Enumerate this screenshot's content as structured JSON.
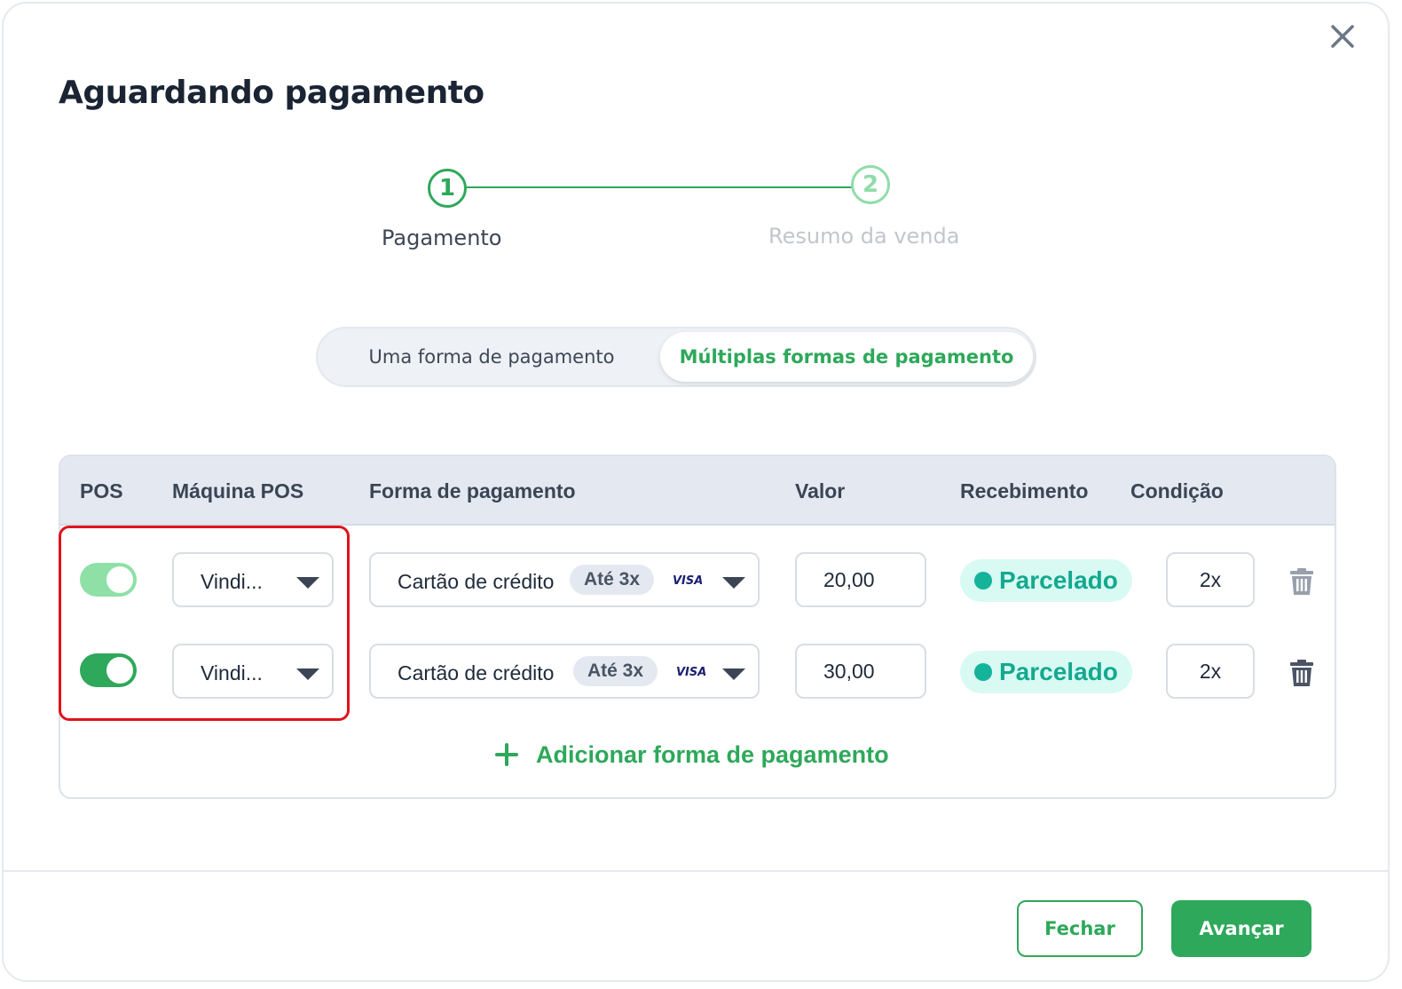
{
  "modal": {
    "title": "Aguardando pagamento",
    "close_icon": "close-icon"
  },
  "stepper": {
    "steps": [
      {
        "number": "1",
        "label": "Pagamento",
        "state": "active"
      },
      {
        "number": "2",
        "label": "Resumo da venda",
        "state": "inactive"
      }
    ]
  },
  "payment_mode": {
    "options": [
      "Uma forma de pagamento",
      "Múltiplas formas de pagamento"
    ],
    "selected": "Múltiplas formas de pagamento"
  },
  "table": {
    "columns": [
      "POS",
      "Máquina POS",
      "Forma de pagamento",
      "Valor",
      "Recebimento",
      "Condição"
    ],
    "rows": [
      {
        "pos_enabled": true,
        "machine": "Vindi...",
        "method": "Cartão de crédito",
        "installments_badge": "Até 3x",
        "card_brand": "VISA",
        "value": "20,00",
        "receipt": "Parcelado",
        "condition": "2x"
      },
      {
        "pos_enabled": true,
        "machine": "Vindi...",
        "method": "Cartão de crédito",
        "installments_badge": "Até 3x",
        "card_brand": "VISA",
        "value": "30,00",
        "receipt": "Parcelado",
        "condition": "2x"
      }
    ],
    "add_label": "Adicionar forma de pagamento"
  },
  "footer": {
    "cancel_label": "Fechar",
    "next_label": "Avançar"
  },
  "colors": {
    "accent": "#2ea85a",
    "accent_light": "#8ee0a7",
    "status_bg": "#d8faf3",
    "status_text": "#14a98f",
    "highlight": "#e0131c"
  }
}
